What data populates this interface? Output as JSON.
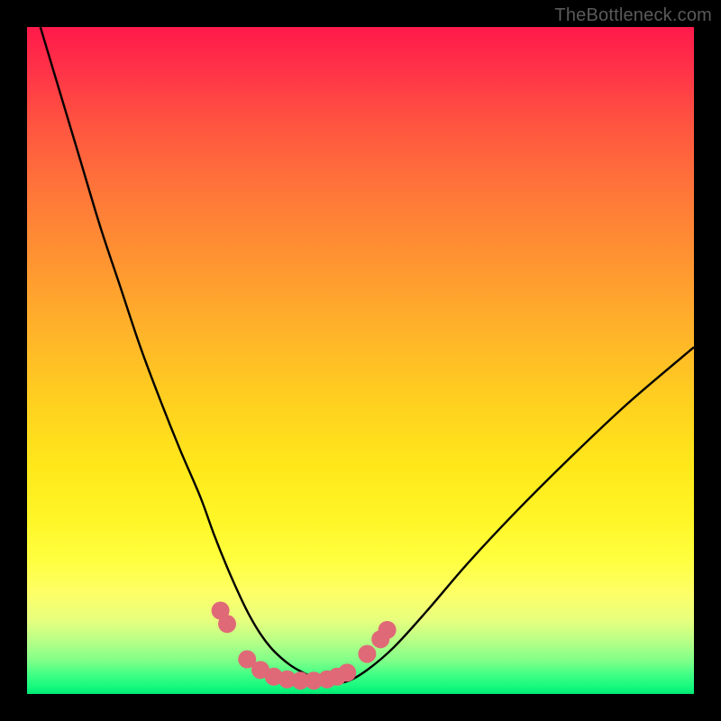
{
  "watermark": {
    "text": "TheBottleneck.com"
  },
  "colors": {
    "page_bg": "#000000",
    "curve_stroke": "#000000",
    "marker_fill": "#e06978",
    "gradient_stops": [
      "#ff1a4a",
      "#ff3148",
      "#ff5640",
      "#ff7a38",
      "#ff9a30",
      "#ffb728",
      "#ffd21f",
      "#ffe81a",
      "#fff628",
      "#ffff40",
      "#fdff68",
      "#e7ff7e",
      "#b8ff87",
      "#80ff88",
      "#44ff85",
      "#14f87e",
      "#00e873"
    ]
  },
  "chart_data": {
    "type": "line",
    "title": "",
    "xlabel": "",
    "ylabel": "",
    "xlim": [
      0,
      100
    ],
    "ylim": [
      0,
      100
    ],
    "grid": false,
    "series": [
      {
        "name": "bottleneck-curve",
        "x": [
          2,
          5,
          8,
          11,
          14,
          17,
          20,
          23,
          26,
          28,
          30,
          32,
          33.5,
          35,
          36.5,
          38,
          39.5,
          41,
          43,
          45,
          48,
          51,
          55,
          60,
          66,
          73,
          81,
          90,
          100
        ],
        "y": [
          100,
          90,
          80,
          70,
          61,
          52,
          44,
          36.5,
          29.5,
          24,
          19,
          14.5,
          11.5,
          9,
          7,
          5.5,
          4.3,
          3.4,
          2.4,
          1.6,
          1.9,
          3.6,
          7,
          12.5,
          19.5,
          27,
          35,
          43.5,
          52
        ]
      }
    ],
    "markers": [
      {
        "name": "marker",
        "x": 29,
        "y": 12.5
      },
      {
        "name": "marker",
        "x": 30,
        "y": 10.5
      },
      {
        "name": "marker",
        "x": 33,
        "y": 5.2
      },
      {
        "name": "marker",
        "x": 35,
        "y": 3.6
      },
      {
        "name": "marker",
        "x": 37,
        "y": 2.6
      },
      {
        "name": "marker",
        "x": 39,
        "y": 2.2
      },
      {
        "name": "marker",
        "x": 41,
        "y": 2.0
      },
      {
        "name": "marker",
        "x": 43,
        "y": 2.0
      },
      {
        "name": "marker",
        "x": 45,
        "y": 2.2
      },
      {
        "name": "marker",
        "x": 46.5,
        "y": 2.6
      },
      {
        "name": "marker",
        "x": 48,
        "y": 3.2
      },
      {
        "name": "marker",
        "x": 51,
        "y": 6.0
      },
      {
        "name": "marker",
        "x": 53,
        "y": 8.2
      },
      {
        "name": "marker",
        "x": 54,
        "y": 9.6
      }
    ]
  }
}
